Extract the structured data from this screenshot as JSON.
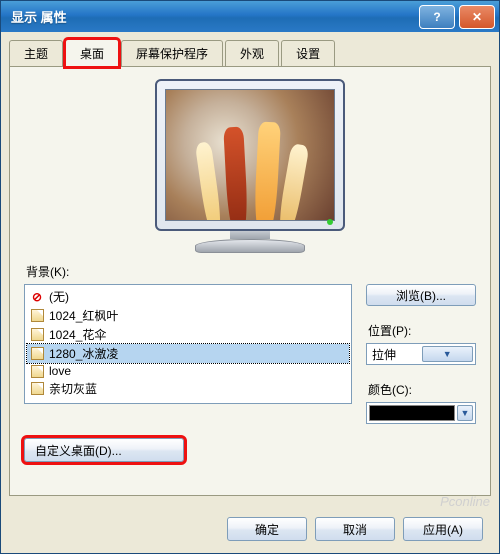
{
  "window": {
    "title": "显示 属性"
  },
  "tabs": {
    "theme": "主题",
    "desktop": "桌面",
    "saver": "屏幕保护程序",
    "look": "外观",
    "setting": "设置"
  },
  "labels": {
    "background": "背景(K):",
    "position": "位置(P):",
    "color": "颜色(C):"
  },
  "bg_list": {
    "none": "(无)",
    "i0": "1024_红枫叶",
    "i1": "1024_花伞",
    "i2": "1280_冰激凌",
    "i3": "love",
    "i4": "亲切灰蓝"
  },
  "side": {
    "browse": "浏览(B)...",
    "pos_value": "拉伸",
    "color_value": "#000000"
  },
  "custom_btn": "自定义桌面(D)...",
  "dlg": {
    "ok": "确定",
    "cancel": "取消",
    "apply": "应用(A)"
  },
  "watermark": "Pconline"
}
